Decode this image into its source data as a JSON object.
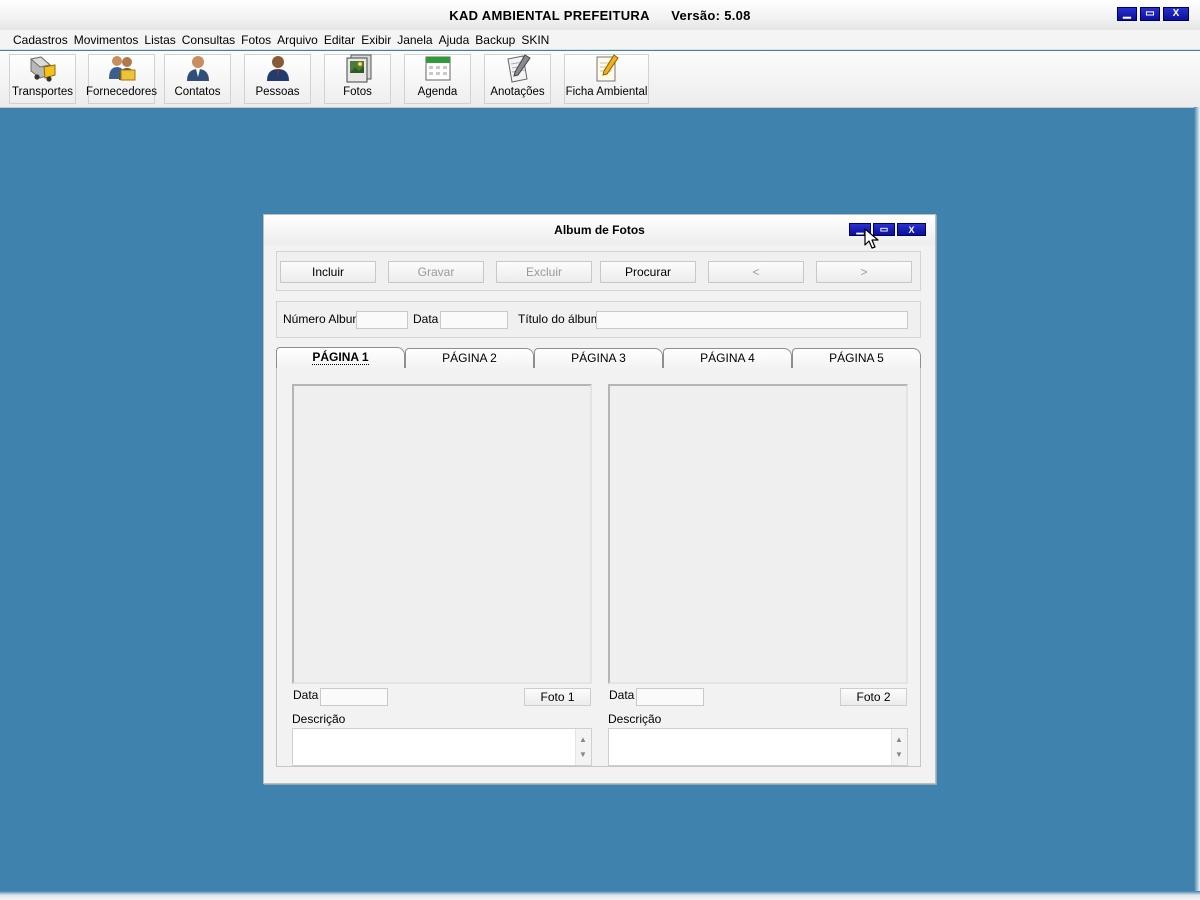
{
  "window": {
    "app_name": "KAD AMBIENTAL PREFEITURA",
    "version": "Versão: 5.08",
    "minimize_glyph": "▁",
    "maximize_glyph": "▭",
    "close_glyph": "X"
  },
  "menu": [
    "Cadastros",
    "Movimentos",
    "Listas",
    "Consultas",
    "Fotos",
    "Arquivo",
    "Editar",
    "Exibir",
    "Janela",
    "Ajuda",
    "Backup",
    "SKIN"
  ],
  "toolbar": {
    "transportes": "Transportes",
    "fornecedores": "Fornecedores",
    "contatos": "Contatos",
    "pessoas": "Pessoas",
    "fotos": "Fotos",
    "agenda": "Agenda",
    "anotacoes": "Anotações",
    "ficha_ambiental": "Ficha Ambiental"
  },
  "icons": {
    "transportes": "truck-icon",
    "fornecedores": "suppliers-icon",
    "contatos": "contact-person-icon",
    "pessoas": "person-icon",
    "fotos": "photo-album-icon",
    "agenda": "calendar-icon",
    "anotacoes": "notepad-icon",
    "ficha_ambiental": "pencil-form-icon"
  },
  "dialog": {
    "title": "Album de Fotos",
    "actions": {
      "incluir": "Incluir",
      "gravar": "Gravar",
      "excluir": "Excluir",
      "procurar": "Procurar",
      "prev": "<",
      "next": ">"
    },
    "fields": {
      "numero_album_label": "Número Album",
      "numero_album_value": "",
      "data_label": "Data",
      "data_value": "",
      "titulo_label": "Título do álbum",
      "titulo_value": ""
    },
    "tabs": [
      "PÁGINA 1",
      "PÁGINA 2",
      "PÁGINA 3",
      "PÁGINA 4",
      "PÁGINA 5"
    ],
    "active_tab": "PÁGINA 1",
    "photos": [
      {
        "data_label": "Data",
        "data_value": "",
        "button": "Foto 1",
        "descricao_label": "Descrição",
        "descricao_value": ""
      },
      {
        "data_label": "Data",
        "data_value": "",
        "button": "Foto 2",
        "descricao_label": "Descrição",
        "descricao_value": ""
      }
    ]
  },
  "colors": {
    "desktop": "#3f82ad",
    "title_button": "#0a0f9a",
    "disabled_text": "#9a9a9a"
  }
}
